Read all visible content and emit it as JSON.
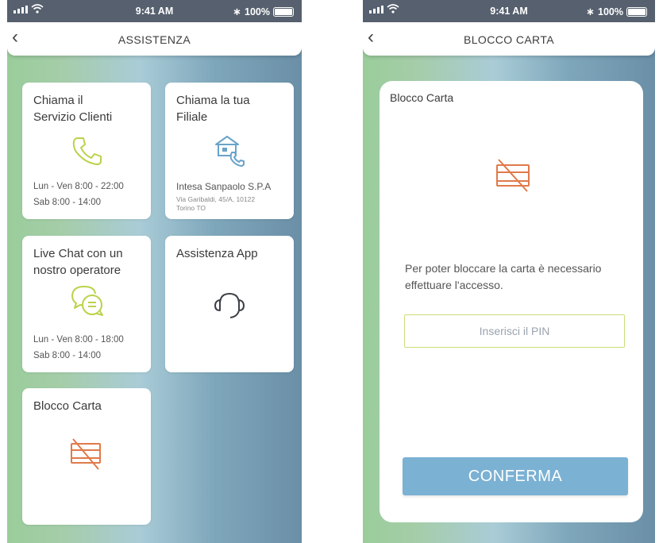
{
  "colors": {
    "accent_orange": "#e07a4a",
    "icon_green": "#b9d34a",
    "icon_blue": "#6aa3c9",
    "confirm_blue": "#7bb1d3",
    "statusbar": "#56606e"
  },
  "statusbar": {
    "time": "9:41 AM",
    "battery": "100%"
  },
  "screen1": {
    "title": "ASSISTENZA",
    "cards": {
      "servizio": {
        "line1": "Chiama il",
        "line2": "Servizio Clienti",
        "icon": "phone-icon",
        "hours1": "Lun - Ven 8:00 - 22:00",
        "hours2": "Sab 8:00 - 14:00"
      },
      "filiale": {
        "line1": "Chiama la tua",
        "line2": "Filiale",
        "icon": "bank-phone-icon",
        "bank": "Intesa Sanpaolo S.P.A",
        "addr1": "Via Garibaldi, 45/A, 10122",
        "addr2": "Torino TO"
      },
      "chat": {
        "line1": "Live Chat con un",
        "line2": "nostro operatore",
        "icon": "chat-bubbles-icon",
        "hours1": "Lun - Ven 8:00 - 18:00",
        "hours2": "Sab 8:00 - 14:00"
      },
      "app": {
        "line1": "Assistenza App",
        "icon": "headset-icon"
      },
      "blocco": {
        "line1": "Blocco Carta",
        "icon": "card-blocked-icon"
      }
    }
  },
  "screen2": {
    "title": "BLOCCO CARTA",
    "card_title": "Blocco Carta",
    "message": "Per poter bloccare la carta è necessario effettuare l'accesso.",
    "pin_placeholder": "Inserisci il PIN",
    "confirm_label": "CONFERMA"
  }
}
